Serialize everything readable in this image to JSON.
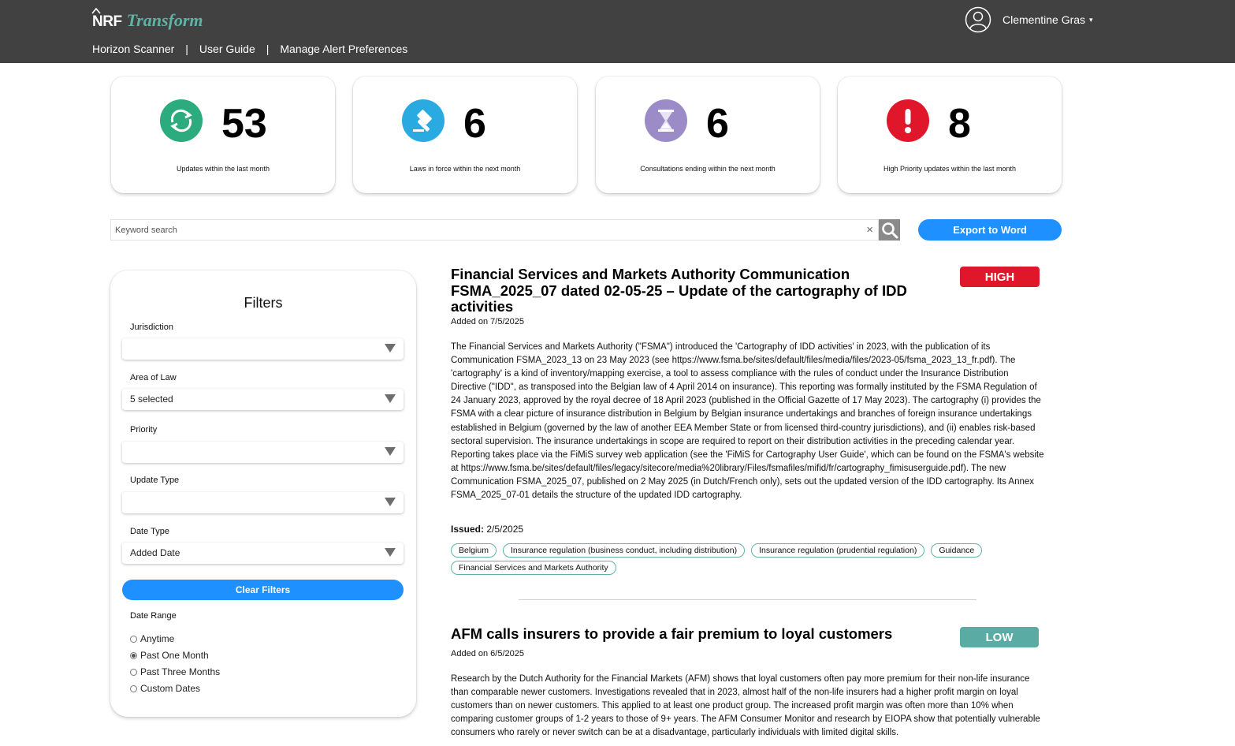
{
  "header": {
    "logo_primary": "NRF",
    "logo_secondary": "Transform",
    "nav": [
      {
        "label": "Horizon Scanner"
      },
      {
        "label": "User Guide"
      },
      {
        "label": "Manage Alert Preferences"
      }
    ],
    "nav_separator": "|",
    "user_name": "Clementine Gras",
    "user_caret": "▾"
  },
  "stats": [
    {
      "value": "53",
      "label": "Updates within the last month",
      "icon": "refresh-icon",
      "color": "#2bab7e"
    },
    {
      "value": "6",
      "label": "Laws in force within the next month",
      "icon": "gavel-icon",
      "color": "#29abe2"
    },
    {
      "value": "6",
      "label": "Consultations ending within the next month",
      "icon": "hourglass-icon",
      "color": "#9b8cc8"
    },
    {
      "value": "8",
      "label": "High Priority updates within the last month",
      "icon": "exclamation-icon",
      "color": "#e0162b"
    }
  ],
  "search": {
    "placeholder": "Keyword search",
    "clear_symbol": "×",
    "export_label": "Export to Word"
  },
  "filters": {
    "title": "Filters",
    "jurisdiction": {
      "label": "Jurisdiction",
      "value": ""
    },
    "area_of_law": {
      "label": "Area of Law",
      "value": "5 selected"
    },
    "priority": {
      "label": "Priority",
      "value": ""
    },
    "update_type": {
      "label": "Update Type",
      "value": ""
    },
    "date_type": {
      "label": "Date Type",
      "value": "Added Date"
    },
    "clear_label": "Clear Filters",
    "date_range": {
      "label": "Date Range",
      "options": [
        "Anytime",
        "Past One Month",
        "Past Three Months",
        "Custom Dates"
      ],
      "selected": "Past One Month"
    }
  },
  "articles": [
    {
      "title": "Financial Services and Markets Authority Communication FSMA_2025_07 dated 02-05-25 – Update of the cartography of IDD activities",
      "priority": "HIGH",
      "priority_color": "#e0162b",
      "added": "Added on 7/5/2025",
      "body": "The Financial Services and Markets Authority (\"FSMA\") introduced the 'Cartography of IDD activities' in 2023, with the publication of its Communication FSMA_2023_13 on 23 May 2023 (see https://www.fsma.be/sites/default/files/media/files/2023-05/fsma_2023_13_fr.pdf). The 'cartography' is a kind of inventory/mapping exercise, a tool to assess compliance with the rules of conduct under the Insurance Distribution Directive (\"IDD\", as transposed into the Belgian law of 4 April 2014 on insurance). This reporting was formally instituted by the FSMA Regulation of 24 January 2023, approved by the royal decree of 18 April 2023 (published in the Official Gazette of 17 May 2023). The cartography (i) provides the FSMA with a clear picture of insurance distribution in Belgium by Belgian insurance undertakings and branches of foreign insurance undertakings established in Belgium (governed by the law of another EEA Member State or from licensed third-country jurisdictions), and (ii) enables risk-based sectoral supervision. The insurance undertakings in scope are required to report on their distribution activities in the preceding calendar year. Reporting takes place via the FiMiS survey web application (see the 'FiMiS for Cartography User Guide', which can be found on the FSMA's website at https://www.fsma.be/sites/default/files/legacy/sitecore/media%20library/Files/fsmafiles/mifid/fr/cartography_fimisuserguide.pdf). The new Communication FSMA_2025_07, published on 2 May 2025 (in Dutch/French only), sets out the updated version of the IDD cartography. Its Annex FSMA_2025_07-01 details the structure of the updated IDD cartography.",
      "issued_label": "Issued:",
      "issued_value": "2/5/2025",
      "tags": [
        "Belgium",
        "Insurance regulation (business conduct, including distribution)",
        "Insurance regulation (prudential regulation)",
        "Guidance",
        "Financial Services and Markets Authority"
      ]
    },
    {
      "title": "AFM calls insurers to provide a fair premium to loyal customers",
      "priority": "LOW",
      "priority_color": "#5aaba3",
      "added": "Added on 6/5/2025",
      "body": "Research by the Dutch Authority for the Financial Markets (AFM) shows that loyal customers often pay more premium for their non-life insurance than comparable newer customers. Investigations revealed that in 2023, almost half of the non-life insurers had a higher profit margin on loyal customers than on newer customers. This applied to at least one product group. The increased profit margin was often more than 10% when comparing customer groups of 1-2 years to those of 9+ years. The AFM Consumer Monitor and research by EIOPA show that potentially vulnerable consumers who rarely or never switch can be at a disadvantage, particularly individuals with limited digital skills."
    }
  ]
}
